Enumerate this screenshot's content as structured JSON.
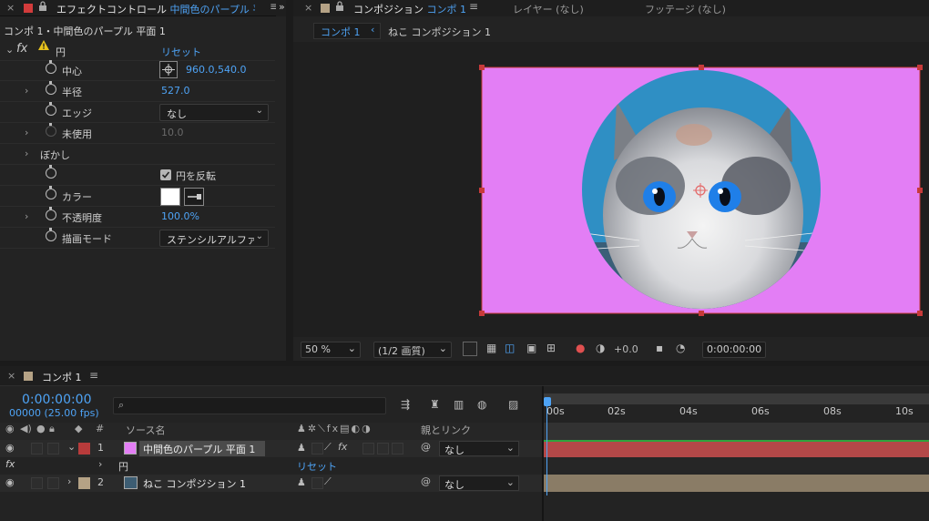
{
  "effect_controls": {
    "tab_title_prefix": "エフェクトコントロール",
    "tab_title_layer": "中間色のパープル 平",
    "subtitle": "コンポ 1・中間色のパープル 平面 1",
    "effect": {
      "fx": "fx",
      "name": "円",
      "reset": "リセット"
    },
    "props": [
      {
        "label": "中心",
        "value": "960.0,540.0"
      },
      {
        "label": "半径",
        "value": "527.0"
      },
      {
        "label": "エッジ",
        "value": "なし"
      },
      {
        "label": "未使用",
        "value": "10.0"
      },
      {
        "label": "ぼかし"
      },
      {
        "label": "円を反転"
      },
      {
        "label": "カラー"
      },
      {
        "label": "不透明度",
        "value": "100.0%"
      },
      {
        "label": "描画モード",
        "value": "ステンシルアルファ"
      }
    ]
  },
  "composition": {
    "tab_label": "コンポジション",
    "tab_comp": "コンポ 1",
    "tab_layer": "レイヤー (なし)",
    "tab_footage": "フッテージ (なし)",
    "breadcrumb_1": "コンポ 1",
    "breadcrumb_2": "ねこ コンポジション 1",
    "magnification": "50 %",
    "resolution": "(1/2 画質)",
    "exposure": "+0.0",
    "timecode": "0:00:00:00",
    "colors": {
      "background": "#e37ef5"
    }
  },
  "timeline": {
    "tab": "コンポ 1",
    "timecode": "0:00:00:00",
    "frames": "00000 (25.00 fps)",
    "search_placeholder": "",
    "col_hash": "#",
    "col_source": "ソース名",
    "col_parent": "親とリンク",
    "ruler": [
      "00s",
      "02s",
      "04s",
      "06s",
      "08s",
      "10s"
    ],
    "layers": [
      {
        "num": "1",
        "name": "中間色のパープル 平面 1",
        "parent": "なし",
        "label_color": "#b83b3b"
      },
      {
        "num": "2",
        "name": "ねこ コンポジション 1",
        "parent": "なし",
        "label_color": "#b5a285"
      }
    ],
    "sub_effect": {
      "fx": "fx",
      "name": "円",
      "reset": "リセット"
    }
  }
}
